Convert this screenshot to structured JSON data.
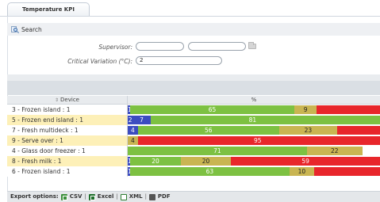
{
  "tab": {
    "label": "Temperature KPI"
  },
  "search": {
    "label": "Search"
  },
  "filters": {
    "supervisor_label": "Supervisor:",
    "supervisor_value1": "",
    "supervisor_value2": "",
    "critical_label": "Critical Variation (°C):",
    "critical_value": "2"
  },
  "grid": {
    "device_header": "Device",
    "pct_header": "%",
    "colors": {
      "blue": "#3b4cc0",
      "green": "#7dc142",
      "olive": "#c9b552",
      "red": "#e8262b"
    },
    "rows": [
      {
        "device": "3 - Frozen island : 1",
        "segments": [
          {
            "color": "blue",
            "value": 1,
            "label": "1"
          },
          {
            "color": "green",
            "value": 65,
            "label": "65"
          },
          {
            "color": "olive",
            "value": 9,
            "label": "9"
          },
          {
            "color": "red",
            "value": 25,
            "label": ""
          }
        ]
      },
      {
        "device": "5 - Frozen end island : 1",
        "segments": [
          {
            "color": "blue",
            "value": 2,
            "label": "2"
          },
          {
            "color": "blue",
            "value": 7,
            "label": "7"
          },
          {
            "color": "green",
            "value": 81,
            "label": "81"
          },
          {
            "color": "green",
            "value": 10,
            "label": ""
          }
        ]
      },
      {
        "device": "7 - Fresh multideck : 1",
        "segments": [
          {
            "color": "blue",
            "value": 4,
            "label": "4"
          },
          {
            "color": "green",
            "value": 56,
            "label": "56"
          },
          {
            "color": "olive",
            "value": 23,
            "label": "23"
          },
          {
            "color": "red",
            "value": 17,
            "label": ""
          }
        ]
      },
      {
        "device": "9 - Serve over : 1",
        "segments": [
          {
            "color": "olive",
            "value": 4,
            "label": "4"
          },
          {
            "color": "red",
            "value": 95,
            "label": "95"
          },
          {
            "color": "red",
            "value": 1,
            "label": ""
          }
        ]
      },
      {
        "device": "4 - Glass door freezer : 1",
        "segments": [
          {
            "color": "green",
            "value": 71,
            "label": "71"
          },
          {
            "color": "olive",
            "value": 22,
            "label": "22"
          }
        ]
      },
      {
        "device": "8 - Fresh milk : 1",
        "segments": [
          {
            "color": "blue",
            "value": 1,
            "label": "1"
          },
          {
            "color": "green",
            "value": 20,
            "label": "20"
          },
          {
            "color": "olive",
            "value": 20,
            "label": "20"
          },
          {
            "color": "red",
            "value": 59,
            "label": "59"
          }
        ]
      },
      {
        "device": "6 - Frozen island : 1",
        "segments": [
          {
            "color": "blue",
            "value": 1,
            "label": "1"
          },
          {
            "color": "green",
            "value": 63,
            "label": "63"
          },
          {
            "color": "olive",
            "value": 10,
            "label": "10"
          },
          {
            "color": "red",
            "value": 26,
            "label": ""
          }
        ]
      }
    ]
  },
  "footer": {
    "export_label": "Export options:",
    "csv": "CSV",
    "excel": "Excel",
    "xml": "XML",
    "pdf": "PDF",
    "separator": "|"
  }
}
